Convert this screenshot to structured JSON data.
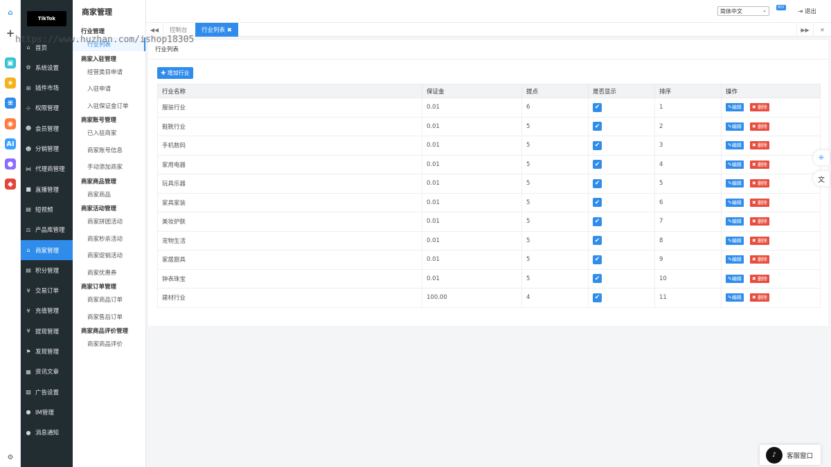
{
  "rail": {
    "icons": [
      "home-icon",
      "plus-icon",
      "app-icon",
      "star-icon",
      "network-icon",
      "ai-ring-icon",
      "ai-icon",
      "chat-bubble-icon",
      "gamepad-icon"
    ],
    "colors": [
      "#2f8ceb",
      "#555555",
      "#37c3d6",
      "#f6b21a",
      "#2f8ceb",
      "#ff7a3c",
      "#3aa0ff",
      "#8b6cff",
      "#e5443a"
    ],
    "settings_icon": "gear-icon"
  },
  "logo": {
    "text": "TikTok"
  },
  "sidebar": {
    "items": [
      {
        "label": "首页",
        "icon": "home"
      },
      {
        "label": "系统设置",
        "icon": "gear"
      },
      {
        "label": "插件市场",
        "icon": "plug"
      },
      {
        "label": "权限管理",
        "icon": "org"
      },
      {
        "label": "会员管理",
        "icon": "users"
      },
      {
        "label": "分销管理",
        "icon": "users"
      },
      {
        "label": "代理商管理",
        "icon": "share"
      },
      {
        "label": "直播管理",
        "icon": "video"
      },
      {
        "label": "短视频",
        "icon": "file"
      },
      {
        "label": "产品库管理",
        "icon": "scale"
      },
      {
        "label": "商家管理",
        "icon": "bank"
      },
      {
        "label": "积分管理",
        "icon": "doc"
      },
      {
        "label": "交易订单",
        "icon": "yen"
      },
      {
        "label": "充值管理",
        "icon": "yen"
      },
      {
        "label": "提现管理",
        "icon": "yen"
      },
      {
        "label": "发现管理",
        "icon": "flag"
      },
      {
        "label": "资讯文章",
        "icon": "news"
      },
      {
        "label": "广告设置",
        "icon": "image"
      },
      {
        "label": "IM管理",
        "icon": "chat"
      },
      {
        "label": "消息通知",
        "icon": "comment"
      }
    ],
    "active_index": 10
  },
  "submenu": {
    "title": "商家管理",
    "groups": [
      {
        "label": "行业管理",
        "links": [
          "行业列表"
        ]
      },
      {
        "label": "商家入驻管理",
        "links": [
          "经营类目申请",
          "入驻申请",
          "入驻保证金订单"
        ]
      },
      {
        "label": "商家账号管理",
        "links": [
          "已入驻商家",
          "商家账号信息",
          "手动添加商家"
        ]
      },
      {
        "label": "商家商品管理",
        "links": [
          "商家商品"
        ]
      },
      {
        "label": "商家活动管理",
        "links": [
          "商家拼团活动",
          "商家秒杀活动",
          "商家促销活动",
          "商家优惠券"
        ]
      },
      {
        "label": "商家订单管理",
        "links": [
          "商家商品订单",
          "商家售后订单"
        ]
      },
      {
        "label": "商家商品评价管理",
        "links": [
          "商家商品评价"
        ]
      }
    ],
    "active_link": "行业列表"
  },
  "topbar": {
    "language": "简体中文",
    "badge": "855",
    "logout": "退出"
  },
  "tabs": [
    {
      "label": "控制台",
      "active": false
    },
    {
      "label": "行业列表 ✖",
      "active": true
    }
  ],
  "panel": {
    "title": "行业列表",
    "add_button": "✚ 增加行业",
    "columns": [
      "行业名称",
      "保证金",
      "提点",
      "是否显示",
      "排序",
      "操作"
    ],
    "rows": [
      {
        "name": "服装行业",
        "deposit": "0.01",
        "rate": "6",
        "visible": true,
        "sort": "1"
      },
      {
        "name": "鞋靴行业",
        "deposit": "0.01",
        "rate": "5",
        "visible": true,
        "sort": "2"
      },
      {
        "name": "手机数码",
        "deposit": "0.01",
        "rate": "5",
        "visible": true,
        "sort": "3"
      },
      {
        "name": "家用电器",
        "deposit": "0.01",
        "rate": "5",
        "visible": true,
        "sort": "4"
      },
      {
        "name": "玩具乐器",
        "deposit": "0.01",
        "rate": "5",
        "visible": true,
        "sort": "5"
      },
      {
        "name": "家具家装",
        "deposit": "0.01",
        "rate": "5",
        "visible": true,
        "sort": "6"
      },
      {
        "name": "美妆护肤",
        "deposit": "0.01",
        "rate": "5",
        "visible": true,
        "sort": "7"
      },
      {
        "name": "宠物生活",
        "deposit": "0.01",
        "rate": "5",
        "visible": true,
        "sort": "8"
      },
      {
        "name": "家居厨具",
        "deposit": "0.01",
        "rate": "5",
        "visible": true,
        "sort": "9"
      },
      {
        "name": "钟表珠宝",
        "deposit": "0.01",
        "rate": "5",
        "visible": true,
        "sort": "10"
      },
      {
        "name": "建材行业",
        "deposit": "100.00",
        "rate": "4",
        "visible": true,
        "sort": "11"
      }
    ],
    "edit_label": "✎编辑",
    "delete_label": "✖ 删除"
  },
  "customer_service": {
    "label": "客服窗口"
  },
  "watermark": "https://www.huzhan.com/ishop18305",
  "colors": {
    "accent": "#2f8ceb",
    "danger": "#e74c3c",
    "sidebar_bg": "#222d32"
  }
}
